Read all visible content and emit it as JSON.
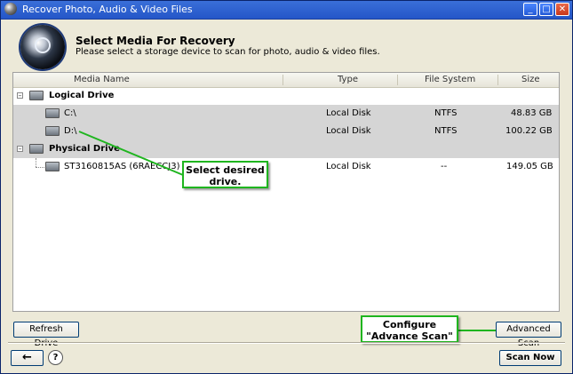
{
  "window": {
    "title": "Recover Photo, Audio & Video Files"
  },
  "header": {
    "title": "Select Media For Recovery",
    "subtitle": "Please select a storage device to scan for photo, audio & video files."
  },
  "table": {
    "columns": [
      "Media Name",
      "Type",
      "File System",
      "Size"
    ],
    "groups": [
      {
        "label": "Logical Drive",
        "expander": "–",
        "rows": [
          {
            "name": "C:\\",
            "type": "Local Disk",
            "fs": "NTFS",
            "size": "48.83 GB"
          },
          {
            "name": "D:\\",
            "type": "Local Disk",
            "fs": "NTFS",
            "size": "100.22 GB"
          }
        ]
      },
      {
        "label": "Physical Drive",
        "expander": "–",
        "rows": [
          {
            "name": "ST3160815AS (6RAECCJ3)",
            "type": "Local Disk",
            "fs": "--",
            "size": "149.05 GB"
          }
        ]
      }
    ]
  },
  "callouts": {
    "select_drive_line1": "Select desired",
    "select_drive_line2": "drive.",
    "configure_line1": "Configure",
    "configure_line2": "\"Advance Scan\""
  },
  "buttons": {
    "refresh_drive": "Refresh Drive",
    "advanced_scan": "Advanced Scan",
    "scan_now": "Scan Now",
    "back_icon": "←",
    "help_icon": "?"
  },
  "titlebar_buttons": {
    "minimize": "_",
    "maximize": "□",
    "close": "✕"
  },
  "colors": {
    "callout_border": "#1fb51f",
    "selected_row": "#d5d5d5",
    "titlebar": "#2456c8"
  }
}
